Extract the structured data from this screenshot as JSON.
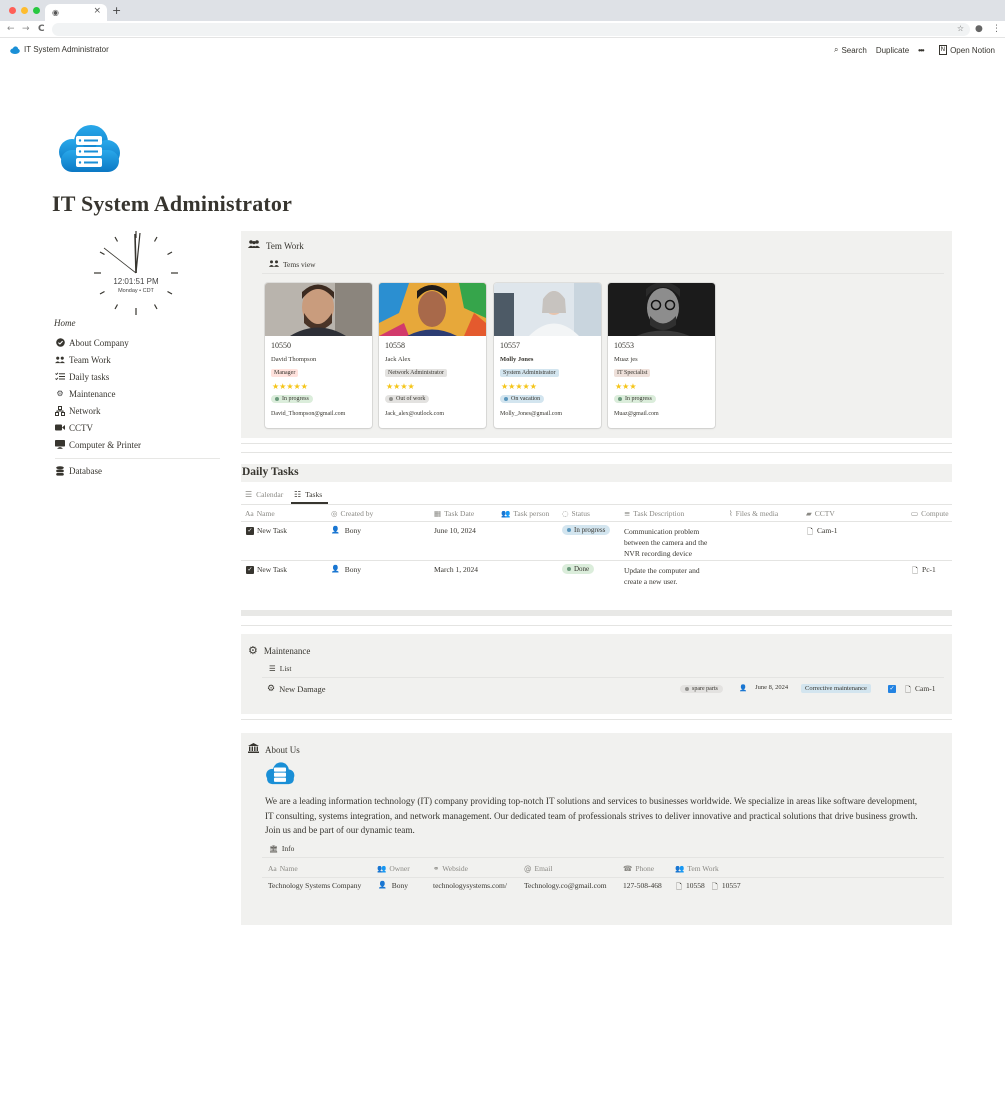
{
  "browser": {
    "tab_icon": "globe-icon",
    "new_tab": "+",
    "back": "←",
    "forward": "→",
    "reload": "C"
  },
  "topbar": {
    "breadcrumb": "IT System Administrator",
    "search": "Search",
    "duplicate": "Duplicate",
    "more": "•••",
    "open_notion": "Open Notion"
  },
  "page": {
    "title": "IT System  Administrator"
  },
  "clock": {
    "time": "12:01:51 PM",
    "date": "Monday • CDT"
  },
  "sidebar": {
    "home": "Home",
    "items": [
      {
        "label": "About Company",
        "icon": "check-badge-icon"
      },
      {
        "label": "Team Work",
        "icon": "people-icon"
      },
      {
        "label": "Daily tasks",
        "icon": "checklist-icon"
      },
      {
        "label": "Maintenance",
        "icon": "gear-icon"
      },
      {
        "label": "Network",
        "icon": "network-icon"
      },
      {
        "label": "CCTV",
        "icon": "camera-icon"
      },
      {
        "label": "Computer & Printer",
        "icon": "monitor-icon"
      }
    ],
    "database": "Database"
  },
  "team": {
    "title": "Tem Work",
    "view": "Tems view",
    "cards": [
      {
        "id": "10550",
        "name": "David Thompson",
        "role": "Manager",
        "role_color": "#ffe2dd",
        "stars": "★★★★★",
        "status": "In progress",
        "status_bg": "#dbeddb",
        "status_dot": "#6c9b7d",
        "email": "David_Thompson@gmail.com"
      },
      {
        "id": "10558",
        "name": "Jack Alex",
        "role": "Network Administrator",
        "role_color": "#e3e2e0",
        "stars": "★★★★",
        "status": "Out of work",
        "status_bg": "#e3e2e0",
        "status_dot": "#91918e",
        "email": "Jack_alex@outlock.com"
      },
      {
        "id": "10557",
        "name": "Molly Jones",
        "role": "System Administrator",
        "role_color": "#d3e5ef",
        "stars": "★★★★★",
        "status": "On vacation",
        "status_bg": "#d3e5ef",
        "status_dot": "#5b97bd",
        "email": "Molly_Jones@gmail.com"
      },
      {
        "id": "10553",
        "name": "Muaz jes",
        "role": "IT Specialist",
        "role_color": "#eee0da",
        "stars": "★★★",
        "status": "In progress",
        "status_bg": "#dbeddb",
        "status_dot": "#6c9b7d",
        "email": "Muaz@gmail.com"
      }
    ]
  },
  "daily": {
    "title": "Daily Tasks",
    "tabs": [
      "Calendar",
      "Tasks"
    ],
    "columns": [
      "Name",
      "Created by",
      "Task Date",
      "Task person",
      "Status",
      "Task Description",
      "Files & media",
      "CCTV",
      "Compute"
    ],
    "rows": [
      {
        "name": "New Task",
        "created_by": "Bony",
        "date": "June 10, 2024",
        "status": "In progress",
        "status_bg": "#d3e5ef",
        "status_dot": "#5b97bd",
        "desc1": "Communication problem",
        "desc2": "between the camera and the",
        "desc3": "NVR recording device",
        "cctv": "Cam-1",
        "computer": ""
      },
      {
        "name": "New Task",
        "created_by": "Bony",
        "date": "March 1, 2024",
        "status": "Done",
        "status_bg": "#dbeddb",
        "status_dot": "#6c9b7d",
        "desc1": "Update the computer and",
        "desc2": "create a new user.",
        "desc3": "",
        "cctv": "",
        "computer": "Pc-1"
      }
    ]
  },
  "maintenance": {
    "title": "Maintenance",
    "view": "List",
    "item": {
      "name": "New Damage",
      "tag": "spare parts",
      "date": "June 8, 2024",
      "type": "Corrective maintenance",
      "cctv": "Cam-1"
    }
  },
  "about": {
    "title": "About Us",
    "text1": "We are a leading information technology (IT) company providing top-notch IT solutions and services to businesses worldwide. We specialize in areas like software development,",
    "text2": "IT consulting, systems integration, and network management. Our dedicated team of professionals strives to deliver innovative and practical solutions that drive business growth.",
    "text3": "Join us and be part of our dynamic team.",
    "info_view": "Info",
    "columns": [
      "Name",
      "Owner",
      "Webside",
      "Email",
      "Phone",
      "Tem Work"
    ],
    "row": {
      "name": "Technology Systems Company",
      "owner": "Bony",
      "web": "technologysystems.com/",
      "email": "Technology.co@gmail.com",
      "phone": "127-508-468",
      "team1": "10558",
      "team2": "10557"
    }
  },
  "colors": {
    "accent_blue": "#2383e2",
    "cloud_blue": "#1a8fd6",
    "block_bg": "#f1f1ef"
  }
}
